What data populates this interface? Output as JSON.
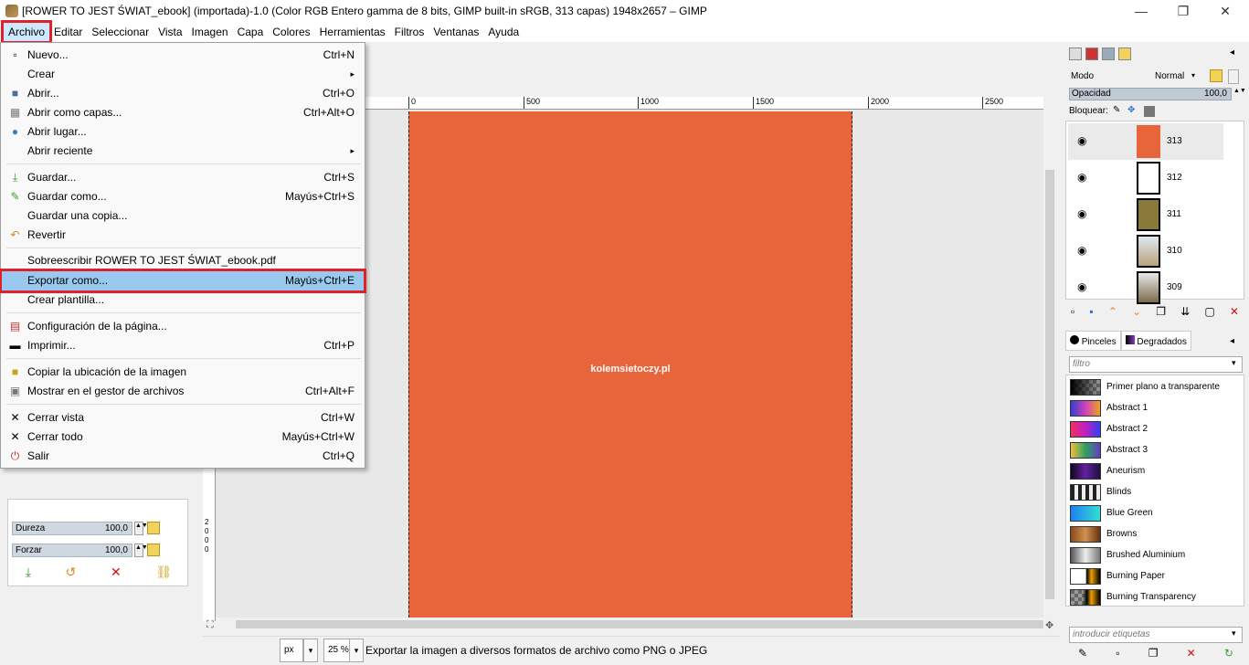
{
  "window": {
    "title": "[ROWER TO JEST ŚWIAT_ebook] (importada)-1.0 (Color RGB Entero gamma de 8 bits, GIMP built-in sRGB, 313 capas) 1948x2657 – GIMP",
    "minimize": "—",
    "maximize": "❐",
    "close": "✕"
  },
  "menubar": [
    "Archivo",
    "Editar",
    "Seleccionar",
    "Vista",
    "Imagen",
    "Capa",
    "Colores",
    "Herramientas",
    "Filtros",
    "Ventanas",
    "Ayuda"
  ],
  "file_menu": {
    "items": [
      {
        "label": "Nuevo...",
        "accel": "Ctrl+N"
      },
      {
        "label": "Crear",
        "accel": "▸"
      },
      {
        "label": "Abrir...",
        "accel": "Ctrl+O"
      },
      {
        "label": "Abrir como capas...",
        "accel": "Ctrl+Alt+O"
      },
      {
        "label": "Abrir lugar...",
        "accel": ""
      },
      {
        "label": "Abrir reciente",
        "accel": "▸"
      },
      {
        "label": "Guardar...",
        "accel": "Ctrl+S"
      },
      {
        "label": "Guardar como...",
        "accel": "Mayús+Ctrl+S"
      },
      {
        "label": "Guardar una copia...",
        "accel": ""
      },
      {
        "label": "Revertir",
        "accel": ""
      },
      {
        "label": "Sobreescribir ROWER TO JEST ŚWIAT_ebook.pdf",
        "accel": ""
      },
      {
        "label": "Exportar como...",
        "accel": "Mayús+Ctrl+E"
      },
      {
        "label": "Crear plantilla...",
        "accel": ""
      },
      {
        "label": "Configuración de la página...",
        "accel": ""
      },
      {
        "label": "Imprimir...",
        "accel": "Ctrl+P"
      },
      {
        "label": "Copiar la ubicación de la imagen",
        "accel": ""
      },
      {
        "label": "Mostrar en el gestor de archivos",
        "accel": "Ctrl+Alt+F"
      },
      {
        "label": "Cerrar vista",
        "accel": "Ctrl+W"
      },
      {
        "label": "Cerrar todo",
        "accel": "Mayús+Ctrl+W"
      },
      {
        "label": "Salir",
        "accel": "Ctrl+Q"
      }
    ]
  },
  "tool_options": {
    "dureza_label": "Dureza",
    "dureza_value": "100,0",
    "forzar_label": "Forzar",
    "forzar_value": "100,0"
  },
  "ruler": {
    "ticks": [
      "0",
      "500",
      "1000",
      "1500",
      "2000",
      "2500"
    ],
    "left_labels": [
      "2",
      "0",
      "0",
      "0"
    ]
  },
  "canvas": {
    "watermark": "kolemsietoczy.pl",
    "image_color": "#e8643a"
  },
  "statusbar": {
    "unit": "px",
    "zoom": "25 %",
    "message": "Exportar la imagen a diversos formatos de archivo como PNG o JPEG"
  },
  "layers_panel": {
    "mode_label": "Modo",
    "mode_value": "Normal",
    "opacity_label": "Opacidad",
    "opacity_value": "100,0",
    "lock_label": "Bloquear:",
    "layers": [
      "313",
      "312",
      "311",
      "310",
      "309"
    ]
  },
  "brushes_panel": {
    "tab_brushes": "Pinceles",
    "tab_gradients": "Degradados",
    "filter_placeholder": "filtro",
    "tags_placeholder": "introducir etiquetas",
    "gradients": [
      "Primer plano a transparente",
      "Abstract 1",
      "Abstract 2",
      "Abstract 3",
      "Aneurism",
      "Blinds",
      "Blue Green",
      "Browns",
      "Brushed Aluminium",
      "Burning Paper",
      "Burning Transparency"
    ]
  }
}
